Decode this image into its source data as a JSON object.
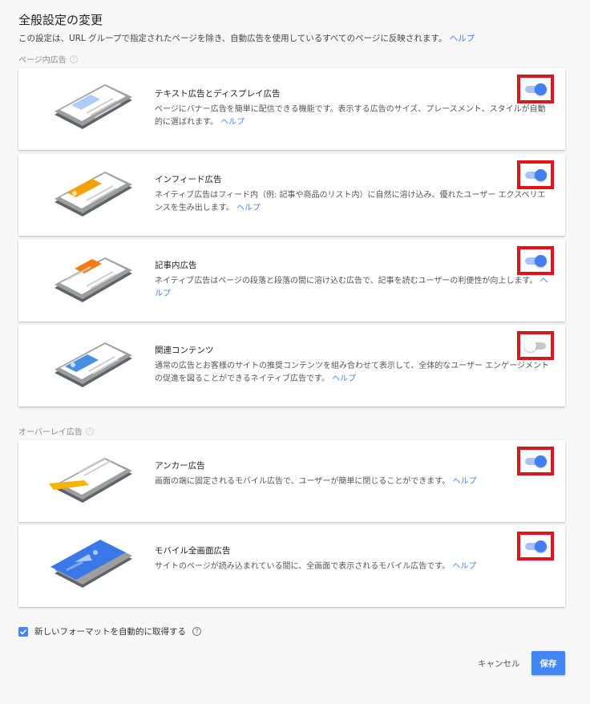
{
  "header": {
    "title": "全般設定の変更",
    "description": "この設定は、URL グループで指定されたページを除き、自動広告を使用しているすべてのページに反映されます。",
    "help_link": "ヘルプ"
  },
  "sections": {
    "in_page": {
      "label": "ページ内広告",
      "help_icon": "?"
    },
    "overlay": {
      "label": "オーバーレイ広告",
      "help_icon": "?"
    }
  },
  "cards": [
    {
      "title": "テキスト広告とディスプレイ広告",
      "description": "ページにバナー広告を簡単に配信できる機能です。表示する広告のサイズ、プレースメント、スタイルが自動的に選ばれます。",
      "help": "ヘルプ",
      "enabled": true,
      "accent": "#7fb0f5"
    },
    {
      "title": "インフィード広告",
      "description": "ネイティブ広告はフィード内（例: 記事や商品のリスト内）に自然に溶け込み、優れたユーザー エクスペリエンスを生み出します。",
      "help": "ヘルプ",
      "enabled": true,
      "accent": "#f4a10e"
    },
    {
      "title": "記事内広告",
      "description": "ネイティブ広告はページの段落と段落の間に溶け込む広告で、記事を読むユーザーの利便性が向上します。",
      "help": "ヘルプ",
      "enabled": true,
      "accent": "#f47c10"
    },
    {
      "title": "関連コンテンツ",
      "description": "通常の広告とお客様のサイトの推奨コンテンツを組み合わせて表示して、全体的なユーザー エンゲージメントの促進を図ることができるネイティブ広告です。",
      "help": "ヘルプ",
      "enabled": false,
      "accent": "#4a90e2"
    },
    {
      "title": "アンカー広告",
      "description": "画面の端に固定されるモバイル広告で、ユーザーが簡単に閉じることができます。",
      "help": "ヘルプ",
      "enabled": true,
      "accent": "#f4b400"
    },
    {
      "title": "モバイル全画面広告",
      "description": "サイトのページが読み込まれている間に、全画面で表示されるモバイル広告です。",
      "help": "ヘルプ",
      "enabled": true,
      "accent": "#3b78e7"
    }
  ],
  "footer": {
    "auto_format_label": "新しいフォーマットを自動的に取得する",
    "auto_format_checked": true,
    "help_icon": "?",
    "cancel_label": "キャンセル",
    "save_label": "保存"
  }
}
